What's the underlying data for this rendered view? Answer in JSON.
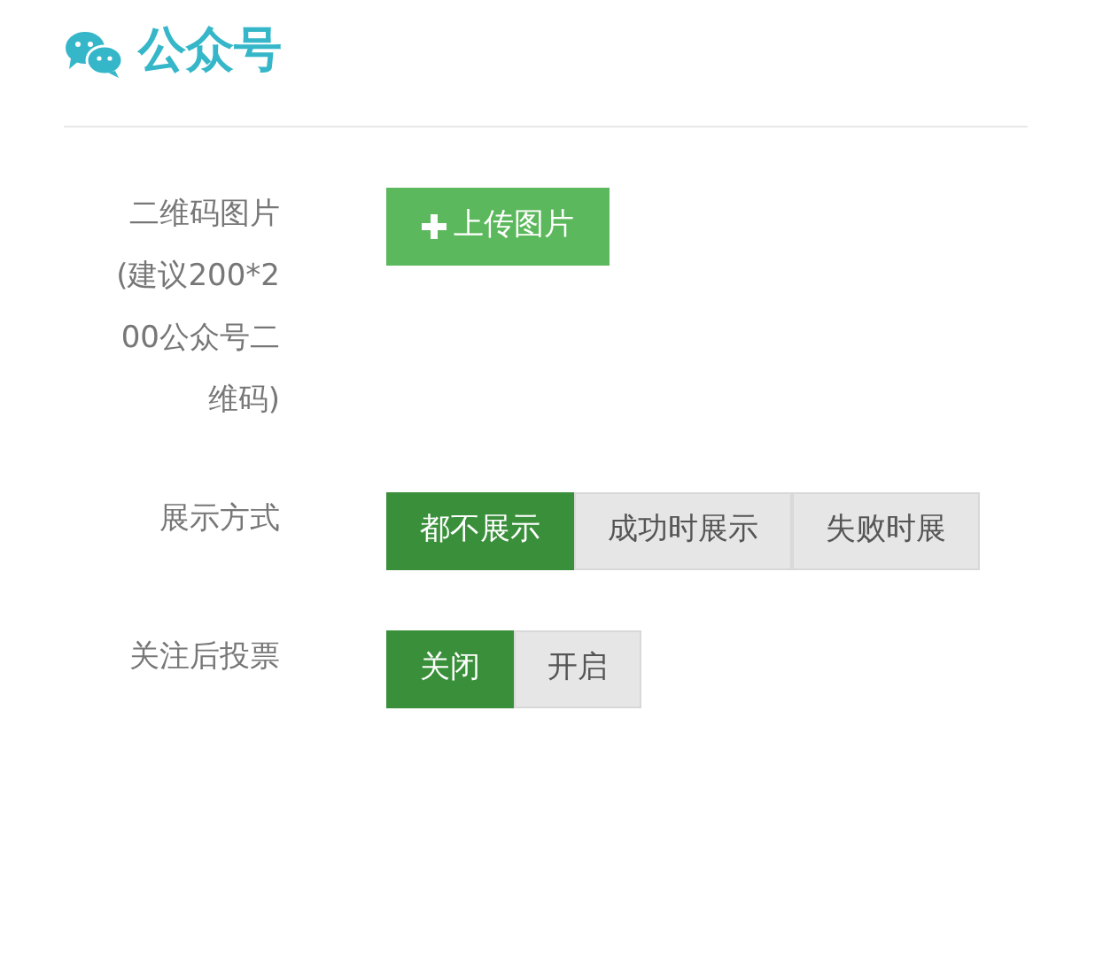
{
  "header": {
    "title": "公众号"
  },
  "fields": [
    {
      "kind": "upload",
      "label": "二维码图片(建议200*200公众号二维码)",
      "button": "上传图片"
    },
    {
      "kind": "segmented",
      "label": "展示方式",
      "options": [
        {
          "label": "都不展示",
          "selected": true
        },
        {
          "label": "成功时展示",
          "selected": false
        },
        {
          "label": "失败时展",
          "selected": false
        }
      ]
    },
    {
      "kind": "segmented",
      "label": "关注后投票",
      "options": [
        {
          "label": "关闭",
          "selected": true
        },
        {
          "label": "开启",
          "selected": false
        }
      ]
    }
  ]
}
